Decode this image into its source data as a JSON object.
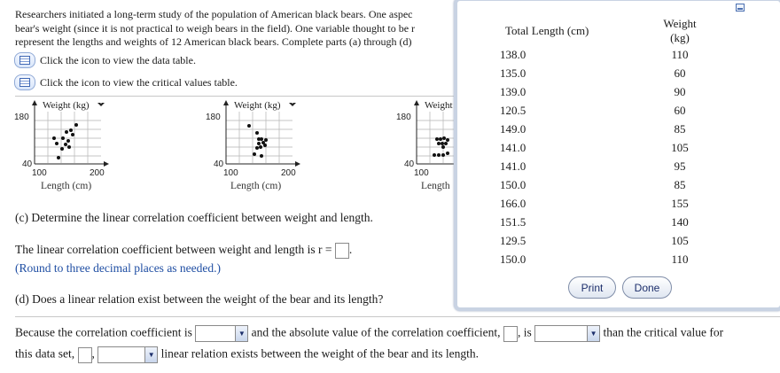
{
  "intro": {
    "line1": "Researchers initiated a long-term study of the population of American black bears. One aspec",
    "line2": "bear's weight (since it is not practical to weigh bears in the field). One variable thought to be r",
    "line3": "represent the lengths and weights of 12 American black bears. Complete parts (a) through (d)"
  },
  "icons": {
    "data_table_text": "Click the icon to view the data table.",
    "critical_values_text": "Click the icon to view the critical values table."
  },
  "plots": [
    {
      "ylabel": "Weight (kg)",
      "ytick_top": "180",
      "ytick_bottom": "40",
      "xtick_left": "100",
      "xtick_right": "200",
      "xlabel": "Length (cm)"
    },
    {
      "ylabel": "Weight (kg)",
      "ytick_top": "180",
      "ytick_bottom": "40",
      "xtick_left": "100",
      "xtick_right": "200",
      "xlabel": "Length (cm)"
    },
    {
      "ylabel": "Weight",
      "ytick_top": "180",
      "ytick_bottom": "40",
      "xtick_left": "100",
      "xtick_right": "",
      "xlabel": "Length"
    }
  ],
  "part_c": {
    "question": "(c) Determine the linear correlation coefficient between weight and length.",
    "answer_prefix": "The linear correlation coefficient between weight and length is r =",
    "answer_suffix": ".",
    "hint": "(Round to three decimal places as needed.)"
  },
  "part_d": {
    "question": "(d) Does a linear relation exist between the weight of the bear and its length?",
    "s1": "Because the correlation coefficient is",
    "s2": "and the absolute value of the correlation coefficient,",
    "s3": ", is",
    "s4": "than the critical value for",
    "s5": "this data set,",
    "s6": ",",
    "s7": "linear relation exists between the weight of the bear and its length.",
    "dropdown1_value": "",
    "dropdown2_value": "",
    "dropdown3_value": ""
  },
  "popup": {
    "headers": [
      "Total Length (cm)",
      "Weight (kg)"
    ],
    "rows": [
      [
        "138.0",
        "110"
      ],
      [
        "135.0",
        "60"
      ],
      [
        "139.0",
        "90"
      ],
      [
        "120.5",
        "60"
      ],
      [
        "149.0",
        "85"
      ],
      [
        "141.0",
        "105"
      ],
      [
        "141.0",
        "95"
      ],
      [
        "150.0",
        "85"
      ],
      [
        "166.0",
        "155"
      ],
      [
        "151.5",
        "140"
      ],
      [
        "129.5",
        "105"
      ],
      [
        "150.0",
        "110"
      ]
    ],
    "print_label": "Print",
    "done_label": "Done"
  },
  "colors": {
    "accent": "#1f4ea3",
    "popup_border": "#c9d3e3",
    "button_text": "#1d2f6b"
  }
}
